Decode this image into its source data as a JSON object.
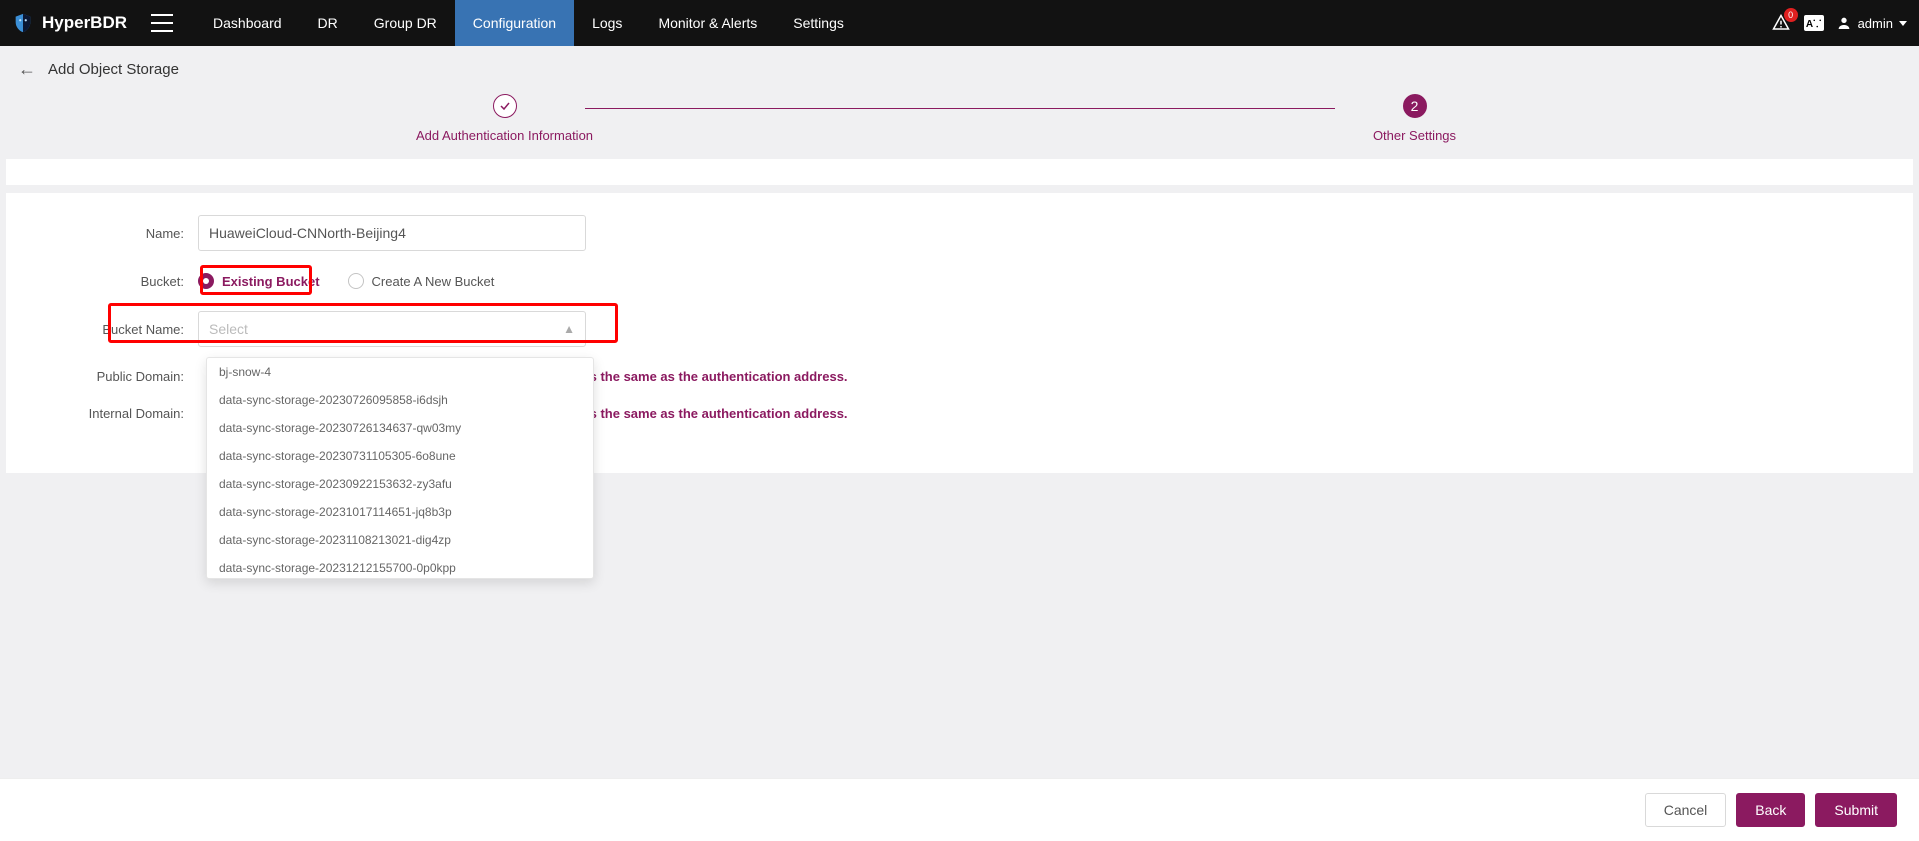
{
  "brand": {
    "name": "HyperBDR"
  },
  "nav": {
    "items": [
      {
        "label": "Dashboard",
        "active": false
      },
      {
        "label": "DR",
        "active": false
      },
      {
        "label": "Group DR",
        "active": false
      },
      {
        "label": "Configuration",
        "active": true
      },
      {
        "label": "Logs",
        "active": false
      },
      {
        "label": "Monitor & Alerts",
        "active": false
      },
      {
        "label": "Settings",
        "active": false
      }
    ]
  },
  "toprightbar": {
    "notif_badge": "0",
    "lang": "A⸪",
    "user": "admin"
  },
  "page": {
    "title": "Add Object Storage"
  },
  "stepper": {
    "step1": {
      "label": "Add Authentication Information",
      "state": "done"
    },
    "step2": {
      "label": "Other Settings",
      "num": "2",
      "state": "current"
    }
  },
  "form": {
    "name": {
      "label": "Name:",
      "value": "HuaweiCloud-CNNorth-Beijing4"
    },
    "bucket": {
      "label": "Bucket:",
      "option_existing": "Existing Bucket",
      "option_create": "Create A New Bucket",
      "selected": "existing"
    },
    "bucket_name": {
      "label": "Bucket Name:",
      "placeholder": "Select",
      "options": [
        "bj-snow-4",
        "data-sync-storage-20230726095858-i6dsjh",
        "data-sync-storage-20230726134637-qw03my",
        "data-sync-storage-20230731105305-6o8une",
        "data-sync-storage-20230922153632-zy3afu",
        "data-sync-storage-20231017114651-jq8b3p",
        "data-sync-storage-20231108213021-dig4zp",
        "data-sync-storage-20231212155700-0p0kpp"
      ]
    },
    "public_domain": {
      "label": "Public Domain:",
      "hint": "is the same as the authentication address."
    },
    "internal_domain": {
      "label": "Internal Domain:",
      "hint": "is the same as the authentication address."
    }
  },
  "footer": {
    "cancel": "Cancel",
    "back": "Back",
    "submit": "Submit"
  }
}
